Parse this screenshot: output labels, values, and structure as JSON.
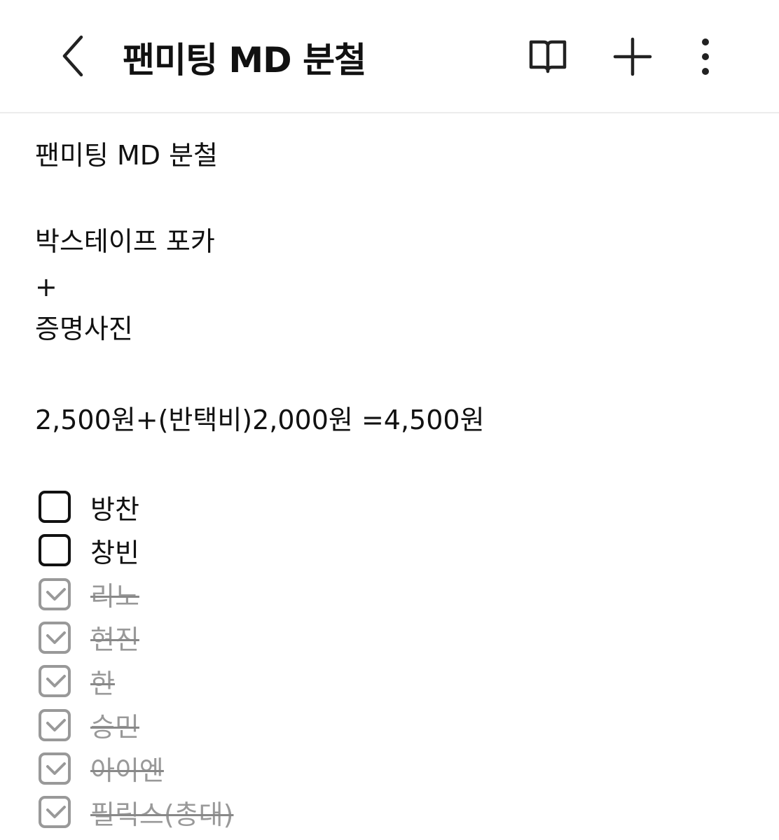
{
  "header": {
    "title": "팬미팅 MD 분철",
    "icons": [
      "back-icon",
      "reading-mode-icon",
      "plus-icon",
      "more-vert-icon"
    ]
  },
  "note": {
    "lines": [
      "팬미팅 MD 분철",
      "박스테이프 포카",
      "+",
      "증명사진",
      "2,500원+(반택비)2,000원  =4,500원"
    ],
    "checklist": [
      {
        "label": "방찬",
        "checked": false
      },
      {
        "label": "창빈",
        "checked": false
      },
      {
        "label": "리노",
        "checked": true
      },
      {
        "label": "현진",
        "checked": true
      },
      {
        "label": "한",
        "checked": true
      },
      {
        "label": "승민",
        "checked": true
      },
      {
        "label": "아이엔",
        "checked": true
      },
      {
        "label": "필릭스(총대)",
        "checked": true
      }
    ]
  },
  "colors": {
    "checked": "#999999",
    "text": "#111111",
    "divider": "#ececec"
  }
}
